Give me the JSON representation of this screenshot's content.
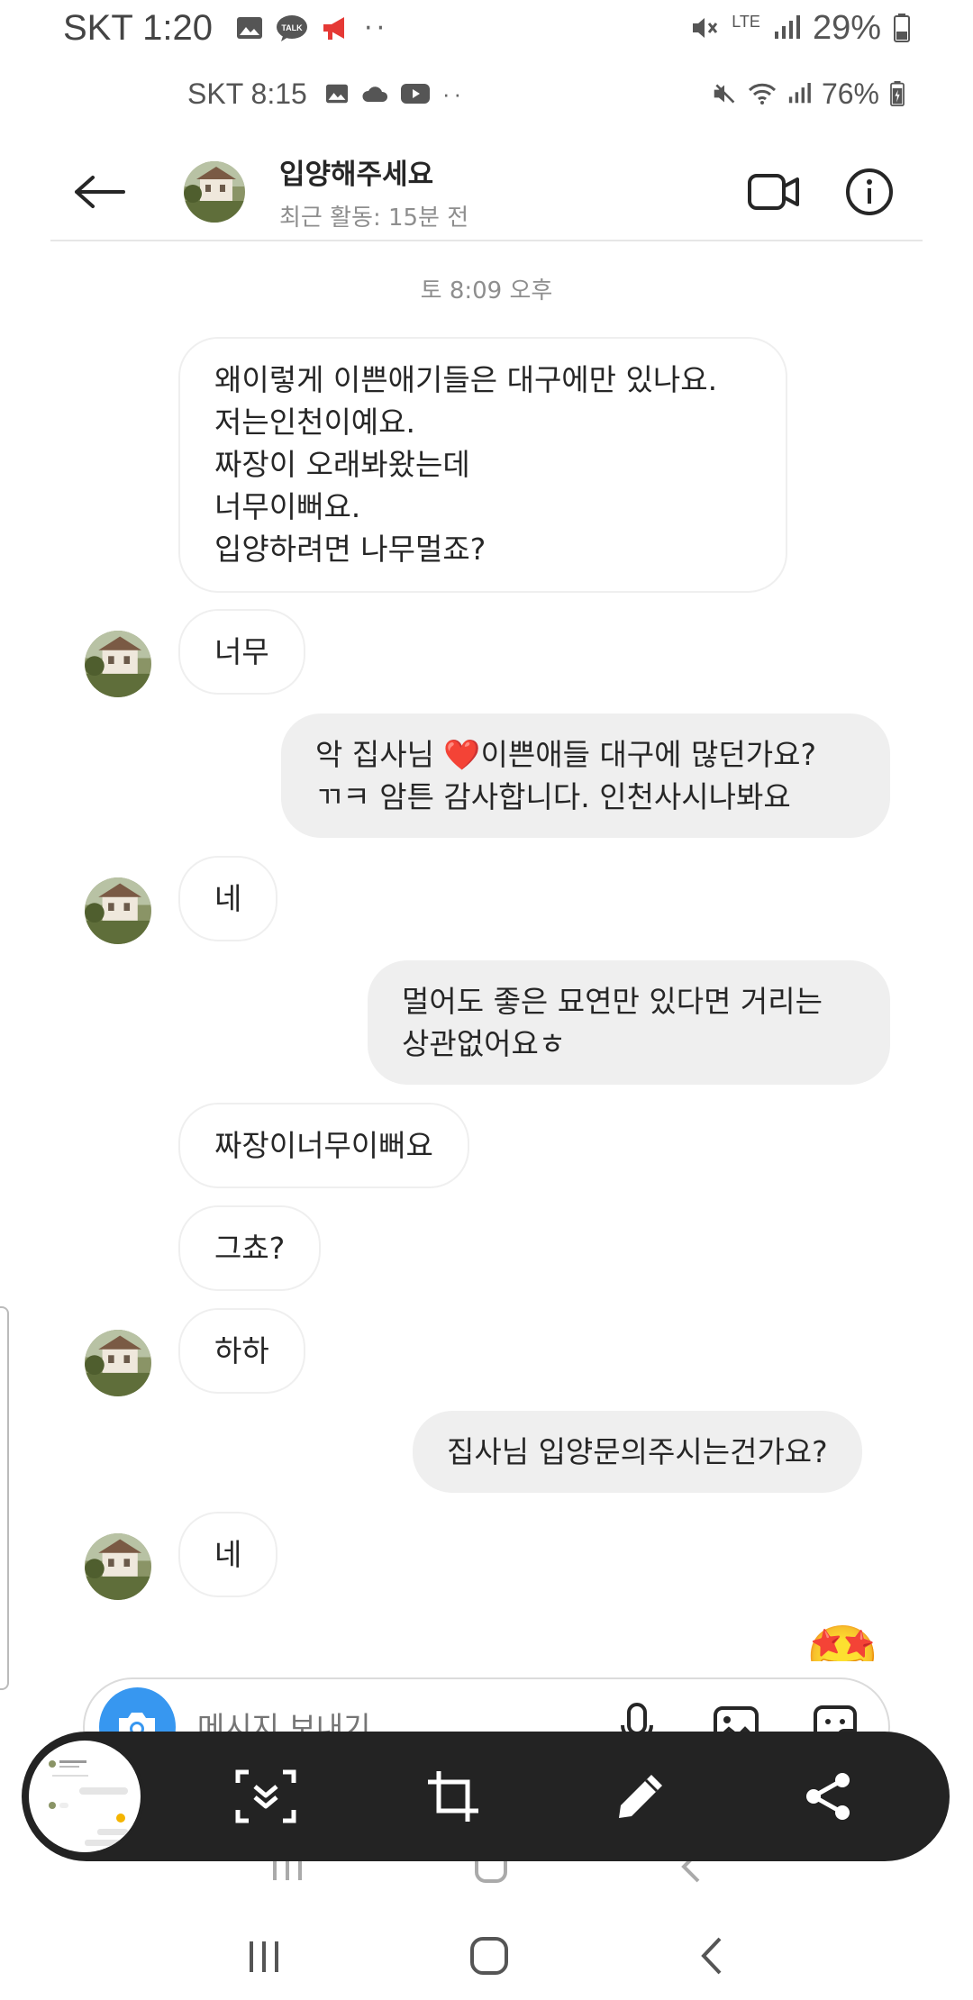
{
  "outer_status": {
    "time": "SKT 1:20",
    "lte": "LTE",
    "battery": "29%"
  },
  "inner_status": {
    "time": "SKT 8:15",
    "battery": "76%"
  },
  "header": {
    "title": "입양해주세요",
    "subtitle": "최근 활동: 15분 전"
  },
  "chat": {
    "timestamp": "토 8:09 오후",
    "messages": [
      {
        "side": "in",
        "lines": [
          "왜이렇게 이쁜애기들은 대구에만 있나요.",
          "저는인천이예요.",
          "짜장이 오래봐왔는데",
          "너무이뻐요.",
          "입양하려면 나무멀죠?"
        ]
      },
      {
        "side": "in",
        "lines": [
          "너무"
        ]
      },
      {
        "side": "out",
        "lines": [
          "악 집사님 ❤️이쁜애들 대구에 많던가요?",
          "ㄲㅋ 암튼 감사합니다. 인천사시나봐요"
        ]
      },
      {
        "side": "in",
        "lines": [
          "네"
        ]
      },
      {
        "side": "out",
        "lines": [
          "멀어도 좋은 묘연만 있다면 거리는",
          "상관없어요ㅎ"
        ]
      },
      {
        "side": "in",
        "lines": [
          "짜장이너무이뻐요"
        ]
      },
      {
        "side": "in",
        "lines": [
          "그쵸?"
        ]
      },
      {
        "side": "in",
        "lines": [
          "하하"
        ]
      },
      {
        "side": "out",
        "lines": [
          "집사님 입양문의주시는건가요?"
        ]
      },
      {
        "side": "in",
        "lines": [
          "네"
        ]
      }
    ],
    "reaction_emoji": "🤩"
  },
  "composer": {
    "placeholder": "메시지 보내기..."
  },
  "colors": {
    "accent": "#3797f0",
    "heart": "#e0245e",
    "toolbar": "#232323"
  },
  "icons": [
    "back-arrow-icon",
    "video-call-icon",
    "info-icon",
    "camera-icon",
    "microphone-icon",
    "gallery-icon",
    "sticker-icon",
    "scroll-capture-icon",
    "crop-icon",
    "pencil-icon",
    "share-icon"
  ]
}
